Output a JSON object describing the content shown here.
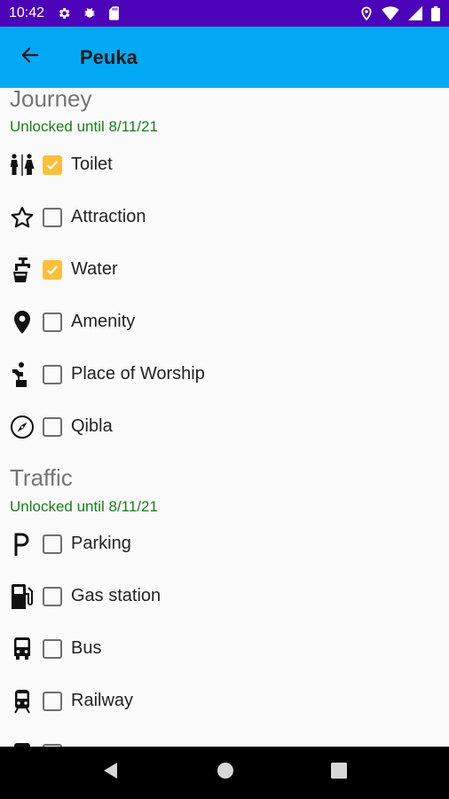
{
  "status_bar": {
    "time": "10:42",
    "left_icons": [
      "gear-icon",
      "bug-icon",
      "sd-card-icon"
    ],
    "right_icons": [
      "location-icon",
      "wifi-icon",
      "signal-icon",
      "battery-icon"
    ]
  },
  "app_bar": {
    "title": "Peuka",
    "back_icon": "arrow-back-icon"
  },
  "sections": [
    {
      "title": "Journey",
      "subtitle": "Unlocked until 8/11/21",
      "items": [
        {
          "label": "Toilet",
          "icon": "toilet-icon",
          "checked": true
        },
        {
          "label": "Attraction",
          "icon": "star-icon",
          "checked": false
        },
        {
          "label": "Water",
          "icon": "water-tap-icon",
          "checked": true
        },
        {
          "label": "Amenity",
          "icon": "map-pin-icon",
          "checked": false
        },
        {
          "label": "Place of Worship",
          "icon": "worship-icon",
          "checked": false
        },
        {
          "label": "Qibla",
          "icon": "compass-icon",
          "checked": false
        }
      ]
    },
    {
      "title": "Traffic",
      "subtitle": "Unlocked until 8/11/21",
      "items": [
        {
          "label": "Parking",
          "icon": "parking-icon",
          "checked": false
        },
        {
          "label": "Gas station",
          "icon": "gas-station-icon",
          "checked": false
        },
        {
          "label": "Bus",
          "icon": "bus-icon",
          "checked": false
        },
        {
          "label": "Railway",
          "icon": "train-icon",
          "checked": false
        }
      ]
    }
  ],
  "nav_bar": {
    "buttons": [
      "back-triangle-icon",
      "home-circle-icon",
      "recents-square-icon"
    ]
  },
  "colors": {
    "status_bar": "#4b02b8",
    "app_bar": "#03a9f4",
    "checkbox_checked": "#fbbf3c",
    "subtitle_green": "#1b7d1b"
  }
}
